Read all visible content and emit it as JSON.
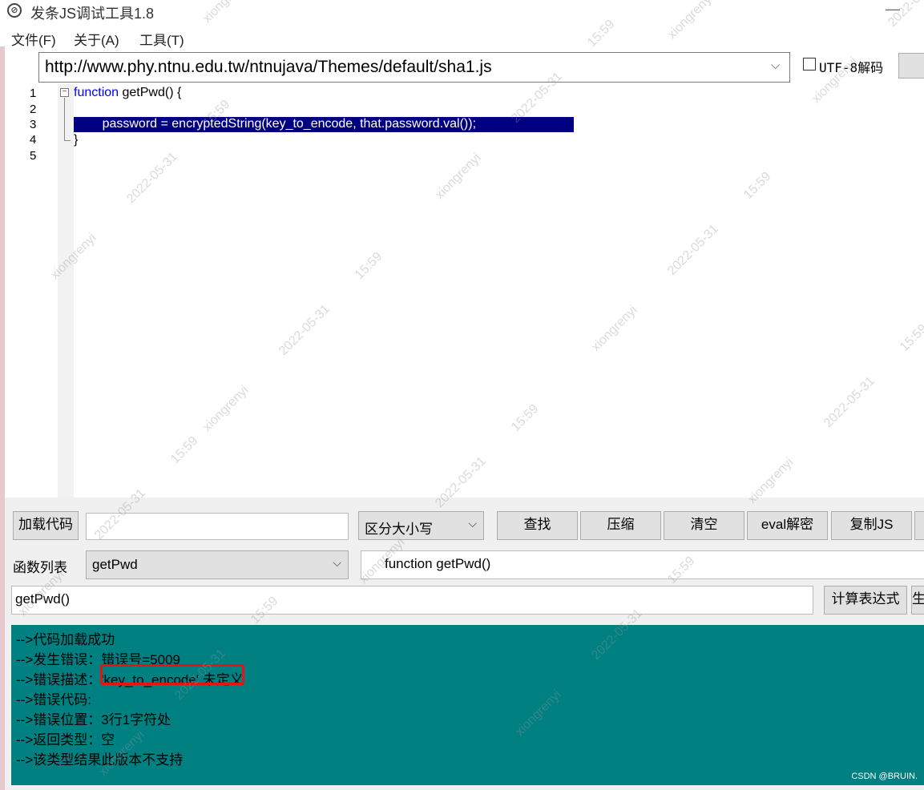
{
  "window": {
    "title": "发条JS调试工具1.8",
    "minimize_glyph": "—"
  },
  "menu": {
    "items": [
      "文件(F)",
      "关于(A)",
      "工具(T)"
    ]
  },
  "toolbar": {
    "url": "http://www.phy.ntnu.edu.tw/ntnujava/Themes/default/sha1.js",
    "utf8_checked": false,
    "utf8_label": "UTF-8解码"
  },
  "editor": {
    "line_numbers": [
      "1",
      "2",
      "3",
      "4",
      "5"
    ],
    "lines": {
      "l1_keyword": "function",
      "l1_rest": " getPwd() {",
      "l3_selected": "        password = encryptedString(key_to_encode, that.password.val());",
      "l4": "}"
    },
    "selection_color": "#000080",
    "keyword_color": "#0000ff"
  },
  "controls": {
    "load_button": "加载代码",
    "load_input": "",
    "case_select": "区分大小写",
    "find_button": "查找",
    "compress_button": "压缩",
    "clear_button": "清空",
    "eval_button": "eval解密",
    "copy_button": "复制JS",
    "func_list_label": "函数列表",
    "func_select": "getPwd",
    "func_signature": "function getPwd()",
    "expr_input": "getPwd()",
    "compute_button": "计算表达式",
    "cut_button": "生"
  },
  "output": {
    "background": "#008080",
    "lines": [
      "-->代码加载成功",
      "-->发生错误：错误号=5009",
      "-->错误描述：'key_to_encode' 未定义",
      "-->错误代码:",
      "-->错误位置：3行1字符处",
      "-->返回类型：空",
      "-->该类型结果此版本不支持"
    ],
    "highlight_color": "#e8130c"
  },
  "watermark": {
    "user": "xiongrenyi",
    "date": "2022-05-31",
    "time": "15:59"
  },
  "credit": "CSDN @BRUIN."
}
